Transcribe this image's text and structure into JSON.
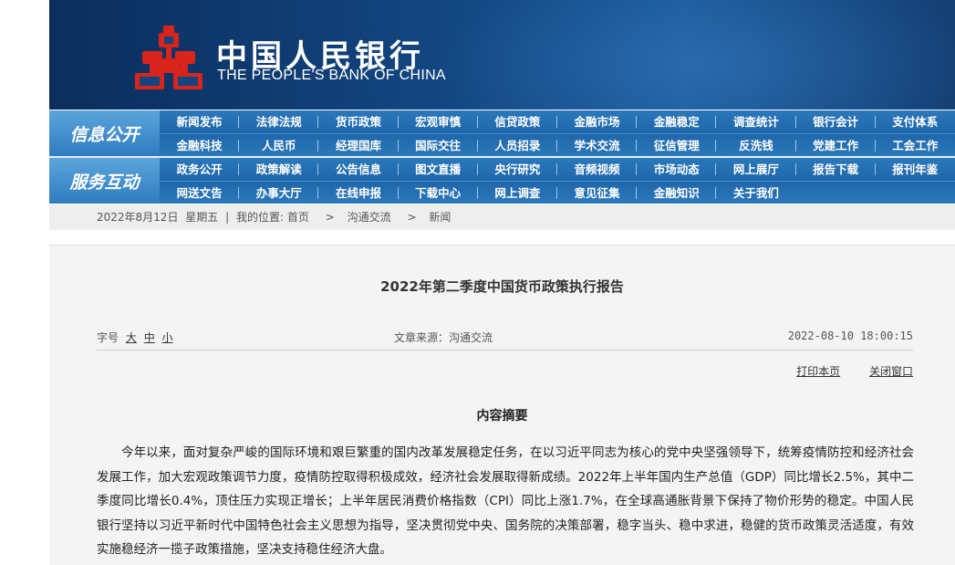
{
  "header": {
    "title_cn": "中国人民银行",
    "title_en": "THE PEOPLE'S BANK OF CHINA",
    "logo_icon": "pboc-logo-icon",
    "colors": {
      "banner": "#12447e",
      "nav": "#2b78bb",
      "logo": "#d9241b"
    }
  },
  "nav": {
    "info_label": "信息公开",
    "info_rows": [
      [
        "新闻发布",
        "法律法规",
        "货币政策",
        "宏观审慎",
        "信贷政策",
        "金融市场",
        "金融稳定",
        "调查统计",
        "银行会计",
        "支付体系"
      ],
      [
        "金融科技",
        "人民币",
        "经理国库",
        "国际交往",
        "人员招录",
        "学术交流",
        "征信管理",
        "反洗钱",
        "党建工作",
        "工会工作"
      ]
    ],
    "service_label": "服务互动",
    "service_rows": [
      [
        "政务公开",
        "政策解读",
        "公告信息",
        "图文直播",
        "央行研究",
        "音频视频",
        "市场动态",
        "网上展厅",
        "报告下载",
        "报刊年鉴"
      ],
      [
        "网送文告",
        "办事大厅",
        "在线申报",
        "下载中心",
        "网上调查",
        "意见征集",
        "金融知识",
        "关于我们"
      ]
    ]
  },
  "breadcrumb": {
    "date": "2022年8月12日",
    "weekday": "星期五",
    "sep": "|",
    "location_label": "我的位置:",
    "home": "首页",
    "arrow": ">",
    "level1": "沟通交流",
    "level2": "新闻"
  },
  "article": {
    "title": "2022年第二季度中国货币政策执行报告",
    "font_size_label": "字号",
    "size_large": "大",
    "size_medium": "中",
    "size_small": "小",
    "source": "文章来源：沟通交流",
    "timestamp": "2022-08-10 18:00:15",
    "print_label": "打印本页",
    "close_label": "关闭窗口",
    "section_title": "内容摘要",
    "paragraph": "今年以来，面对复杂严峻的国际环境和艰巨繁重的国内改革发展稳定任务，在以习近平同志为核心的党中央坚强领导下，统筹疫情防控和经济社会发展工作，加大宏观政策调节力度，疫情防控取得积极成效，经济社会发展取得新成绩。2022年上半年国内生产总值（GDP）同比增长2.5%，其中二季度同比增长0.4%，顶住压力实现正增长；上半年居民消费价格指数（CPI）同比上涨1.7%，在全球高通胀背景下保持了物价形势的稳定。中国人民银行坚持以习近平新时代中国特色社会主义思想为指导，坚决贯彻党中央、国务院的决策部署，稳字当头、稳中求进，稳健的货币政策灵活适度，有效实施稳经济一揽子政策措施，坚决支持稳住经济大盘。"
  }
}
